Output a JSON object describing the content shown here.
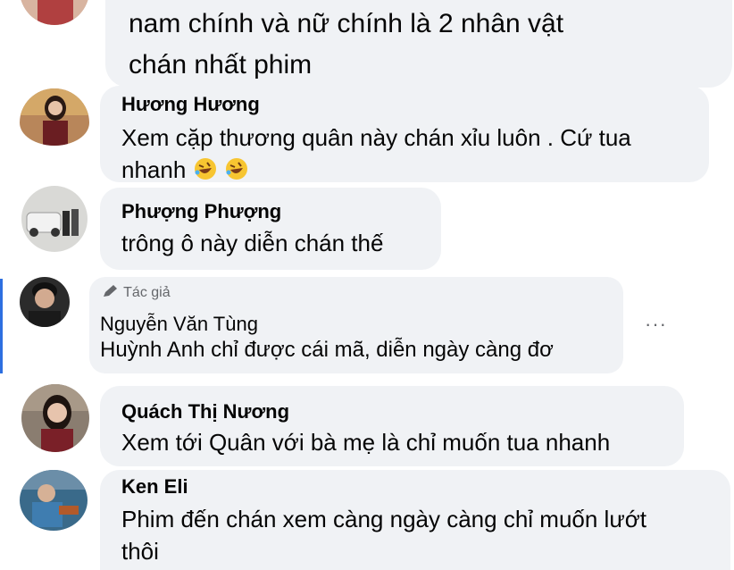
{
  "comments": [
    {
      "name": "",
      "text_lines": [
        "nam chính và nữ chính là 2 nhân vật",
        "chán nhất phim"
      ]
    },
    {
      "name": "Hương Hương",
      "text_lines": [
        "Xem cặp thương quân này chán xỉu luôn . Cứ tua",
        "nhanh"
      ],
      "emoji": "rolling-on-floor-laughing-emoji"
    },
    {
      "name": "Phượng Phượng",
      "text_lines": [
        "trông ô này diễn chán thế"
      ]
    },
    {
      "name": "Nguyễn Văn Tùng",
      "badge": "Tác giả",
      "text_lines": [
        "Huỳnh Anh chỉ được cái mã, diễn ngày càng đơ"
      ],
      "more": "···"
    },
    {
      "name": "Quách Thị Nương",
      "text_lines": [
        "Xem tới Quân với bà mẹ là chỉ muốn tua nhanh"
      ]
    },
    {
      "name": "Ken Eli",
      "text_lines": [
        "Phim đến chán xem càng ngày càng chỉ muốn lướt",
        "thôi"
      ]
    }
  ],
  "colors": {
    "bubble": "#f0f2f5",
    "author_bar": "#2d6fe0",
    "meta_text": "#65676b"
  }
}
